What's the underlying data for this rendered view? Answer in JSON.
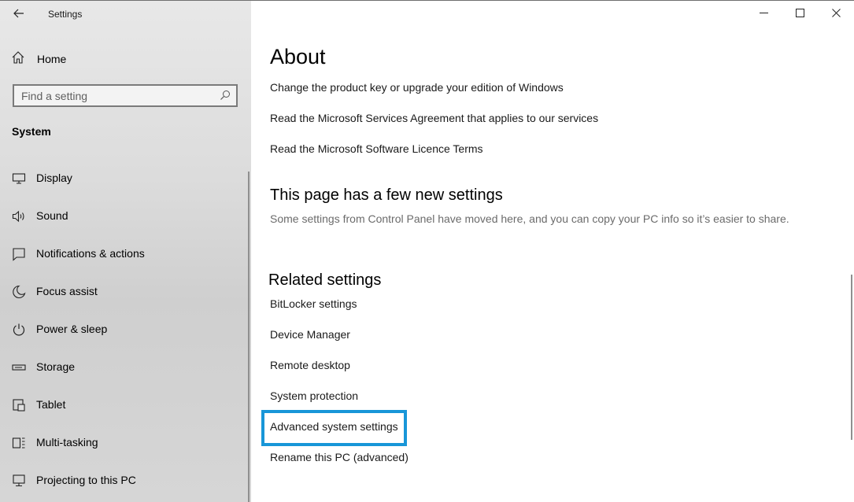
{
  "window": {
    "title": "Settings"
  },
  "sidebar": {
    "home_label": "Home",
    "search": {
      "placeholder": "Find a setting",
      "value": ""
    },
    "section_heading": "System",
    "items": [
      {
        "label": "Display",
        "icon": "display-icon"
      },
      {
        "label": "Sound",
        "icon": "speaker-icon"
      },
      {
        "label": "Notifications & actions",
        "icon": "notification-icon"
      },
      {
        "label": "Focus assist",
        "icon": "moon-icon"
      },
      {
        "label": "Power & sleep",
        "icon": "power-icon"
      },
      {
        "label": "Storage",
        "icon": "storage-icon"
      },
      {
        "label": "Tablet",
        "icon": "tablet-icon"
      },
      {
        "label": "Multi-tasking",
        "icon": "multitasking-icon"
      },
      {
        "label": "Projecting to this PC",
        "icon": "projecting-icon"
      }
    ]
  },
  "main": {
    "title": "About",
    "links_top": [
      "Change the product key or upgrade your edition of Windows",
      "Read the Microsoft Services Agreement that applies to our services",
      "Read the Microsoft Software Licence Terms"
    ],
    "new_settings": {
      "heading": "This page has a few new settings",
      "description": "Some settings from Control Panel have moved here, and you can copy your PC info so it’s easier to share."
    },
    "related": {
      "heading": "Related settings",
      "links": [
        "BitLocker settings",
        "Device Manager",
        "Remote desktop",
        "System protection",
        "Advanced system settings",
        "Rename this PC (advanced)"
      ]
    }
  },
  "colors": {
    "highlight": "#1896d8",
    "sidebar_bg": "#dcdcdc"
  }
}
